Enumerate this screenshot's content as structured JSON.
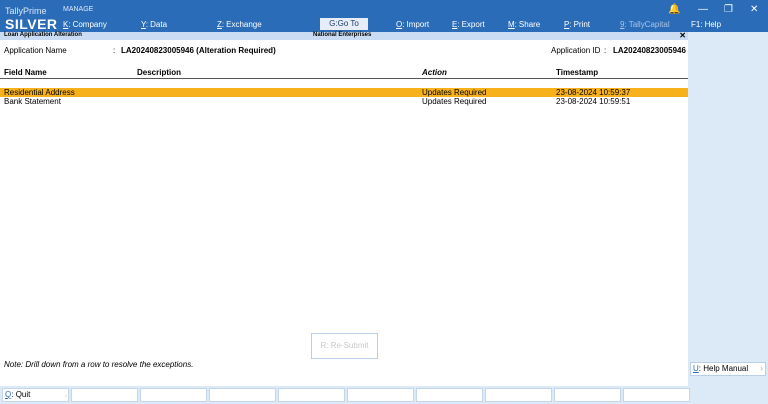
{
  "header": {
    "brand_line1": "TallyPrime",
    "brand_line2": "SILVER",
    "manage_label": "MANAGE",
    "menu": [
      {
        "key": "K",
        "label": "Company"
      },
      {
        "key": "Y",
        "label": "Data"
      },
      {
        "key": "Z",
        "label": "Exchange"
      },
      {
        "key": "G",
        "label": "Go To"
      },
      {
        "key": "O",
        "label": "Import"
      },
      {
        "key": "E",
        "label": "Export"
      },
      {
        "key": "M",
        "label": "Share"
      },
      {
        "key": "P",
        "label": "Print"
      },
      {
        "key": "9",
        "label": "TallyCapital"
      },
      {
        "key": "F1",
        "label": "Help"
      }
    ],
    "window_controls": {
      "bell": "🔔",
      "minimize": "—",
      "restore": "❐",
      "close": "✕"
    }
  },
  "titlebar": {
    "screen_title": "Loan Application Alteration",
    "company": "National Enterprises",
    "close": "✕"
  },
  "form": {
    "app_name_label": "Application Name",
    "app_name_value": "LA20240823005946 (Alteration Required)",
    "app_id_label": "Application ID",
    "app_id_value": "LA20240823005946",
    "colon": ":"
  },
  "table": {
    "headers": {
      "field": "Field Name",
      "description": "Description",
      "action": "Action",
      "timestamp": "Timestamp"
    },
    "rows": [
      {
        "field": "Residential Address",
        "description": "",
        "action": "Updates Required",
        "timestamp": "23-08-2024 10:59:37",
        "selected": true
      },
      {
        "field": "Bank Statement",
        "description": "",
        "action": "Updates Required",
        "timestamp": "23-08-2024 10:59:51",
        "selected": false
      }
    ]
  },
  "resubmit_button": "R: Re-Submit",
  "note": "Note: Drill down from a row to resolve the exceptions.",
  "right_panel": {
    "help_manual": {
      "key": "U",
      "label": "Help Manual"
    }
  },
  "footer": {
    "quit": {
      "key": "Q",
      "label": "Quit"
    }
  },
  "colors": {
    "topbar": "#2b6cb8",
    "selected_row": "#f7b21b",
    "panel": "#dce9f7"
  }
}
